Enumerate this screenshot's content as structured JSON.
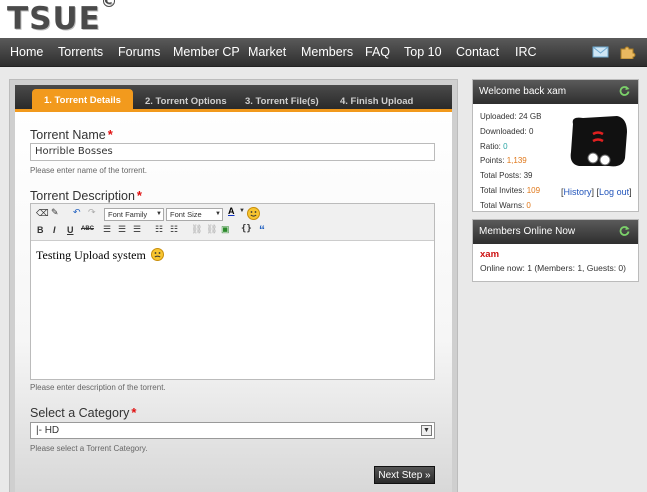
{
  "header": {
    "logo": "TSUE",
    "logo_mark": "C"
  },
  "nav": {
    "items": [
      "Home",
      "Torrents",
      "Forums",
      "Member CP",
      "Market",
      "Members",
      "FAQ",
      "Top 10",
      "Contact",
      "IRC"
    ],
    "icons": [
      "mail-icon",
      "puzzle-icon"
    ]
  },
  "tabs": [
    "1. Torrent Details",
    "2. Torrent Options",
    "3. Torrent File(s)",
    "4. Finish Upload"
  ],
  "form": {
    "name_label": "Torrent Name",
    "name_value": "Horrible Bosses",
    "name_hint": "Please enter name of the torrent.",
    "desc_label": "Torrent Description",
    "desc_hint": "Please enter description of the torrent.",
    "font_family": "Font Family",
    "font_size": "Font Size",
    "editor_text": "Testing Upload system",
    "category_label": "Select a Category",
    "category_value": "|- HD",
    "category_hint": "Please select a Torrent Category.",
    "required_mark": "*",
    "next_button": "Next Step »"
  },
  "welcome": {
    "title": "Welcome back xam",
    "uploaded_label": "Uploaded:",
    "uploaded": "24 GB",
    "downloaded_label": "Downloaded:",
    "downloaded": "0",
    "ratio_label": "Ratio:",
    "ratio": "0",
    "points_label": "Points:",
    "points": "1,139",
    "posts_label": "Total Posts:",
    "posts": "39",
    "invites_label": "Total Invites:",
    "invites": "109",
    "warns_label": "Total Warns:",
    "warns": "0",
    "history_link": "History",
    "logout_link": "Log out"
  },
  "online": {
    "title": "Members Online Now",
    "member": "xam",
    "summary": "Online now: 1 (Members: 1, Guests: 0)"
  },
  "colors": {
    "accent": "#f29a1d",
    "nav_bg": "#3a3a3a",
    "link": "#2255bb",
    "stat_orange": "#e0781a",
    "stat_teal": "#2aa5a5"
  }
}
